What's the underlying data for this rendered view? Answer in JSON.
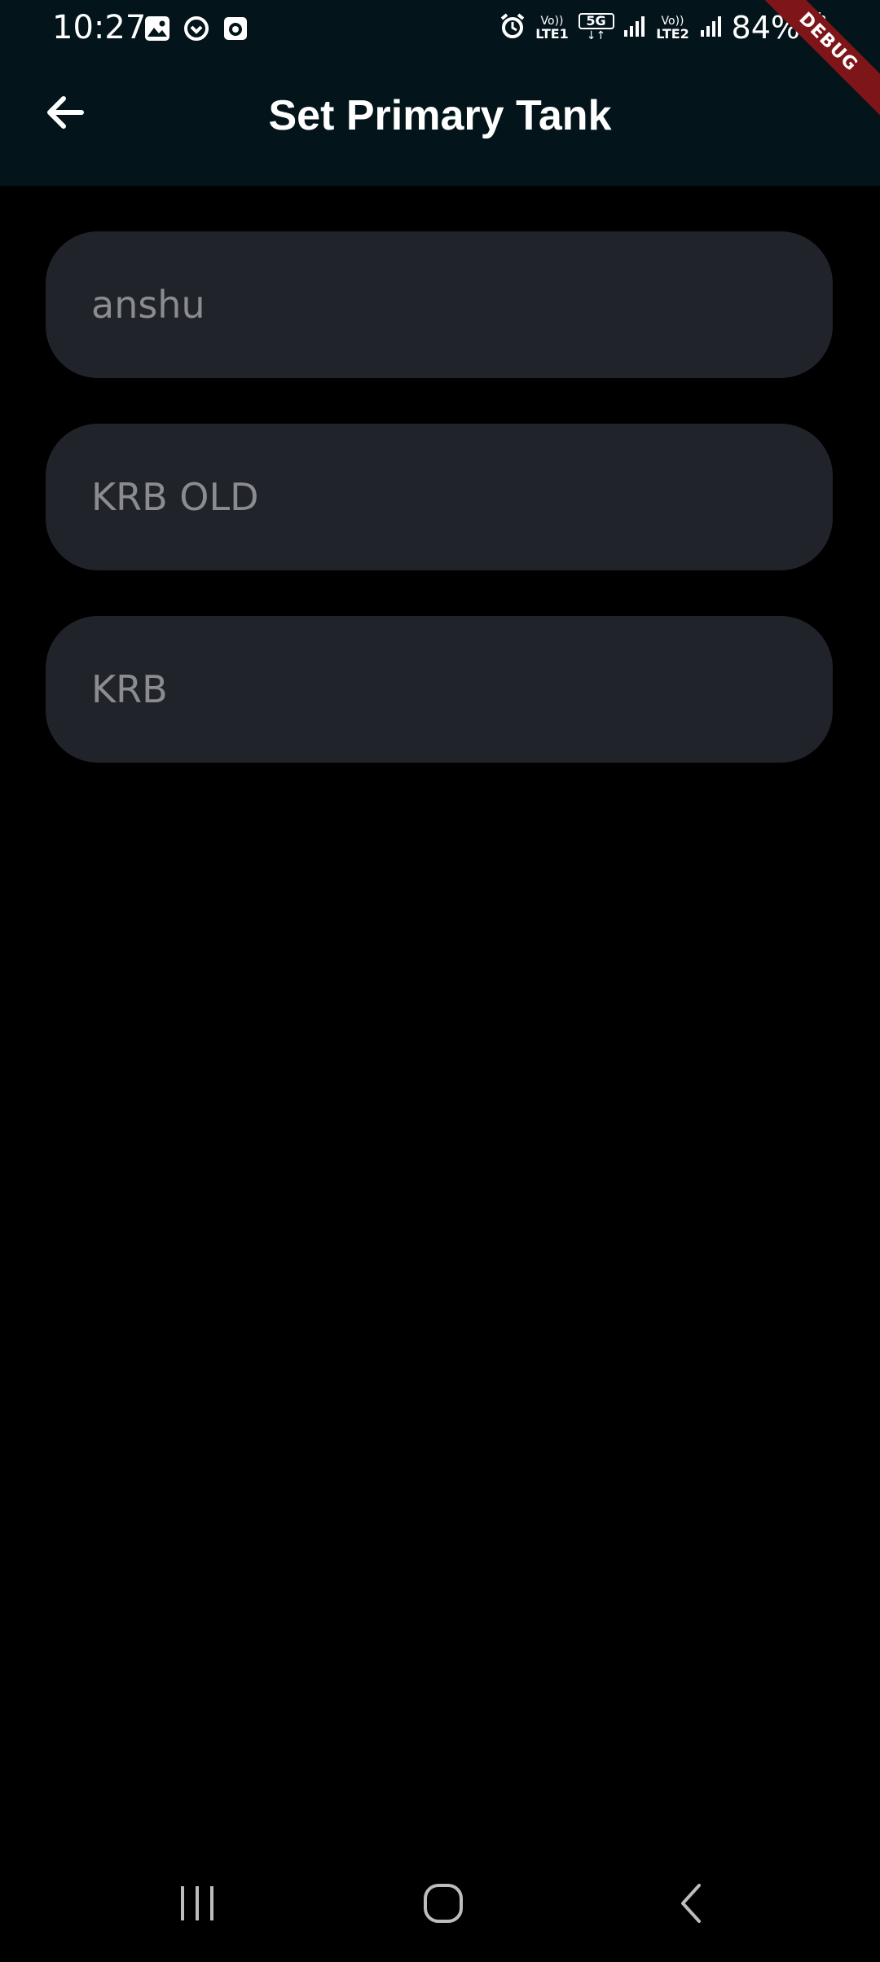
{
  "status_bar": {
    "time": "10:27",
    "sim1_label_top": "Vo))",
    "sim1_label_bottom": "LTE1",
    "network_type": "5G",
    "sim2_label_top": "Vo))",
    "sim2_label_bottom": "LTE2",
    "battery_percent": "84%",
    "left_icons": [
      "gallery-icon",
      "sync-icon",
      "clock-app-icon"
    ],
    "right_icons": [
      "alarm-icon",
      "signal-icon",
      "battery-icon"
    ]
  },
  "debug_banner": {
    "label": "DEBUG",
    "color": "#7e1519"
  },
  "app_bar": {
    "title": "Set Primary Tank",
    "back_icon": "arrow-left-icon",
    "background": "#03141b"
  },
  "tanks": [
    {
      "name": "anshu"
    },
    {
      "name": "KRB OLD"
    },
    {
      "name": "KRB"
    }
  ],
  "nav_bar": {
    "buttons": [
      "recents-icon",
      "home-icon",
      "back-icon"
    ]
  },
  "colors": {
    "background": "#000000",
    "card": "#202329",
    "card_text": "#8a8c90",
    "title_text": "#ffffff"
  }
}
